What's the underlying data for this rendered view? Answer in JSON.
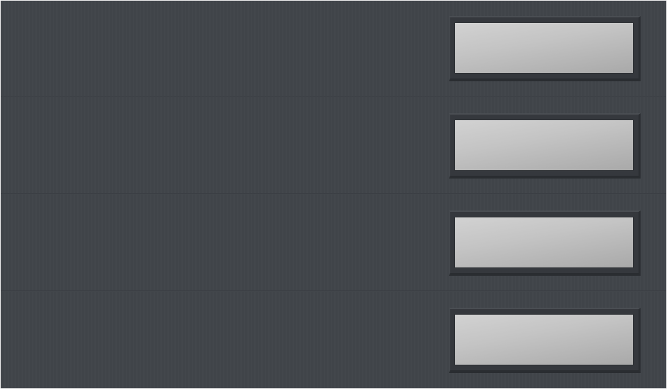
{
  "scene": {
    "subject": "garage-door",
    "panel_count": 4,
    "window_count": 4,
    "colors": {
      "door": "#41454a",
      "frame": "#35383d",
      "glass_light": "#d2d2d2",
      "glass_dark": "#a9a9a9"
    }
  }
}
